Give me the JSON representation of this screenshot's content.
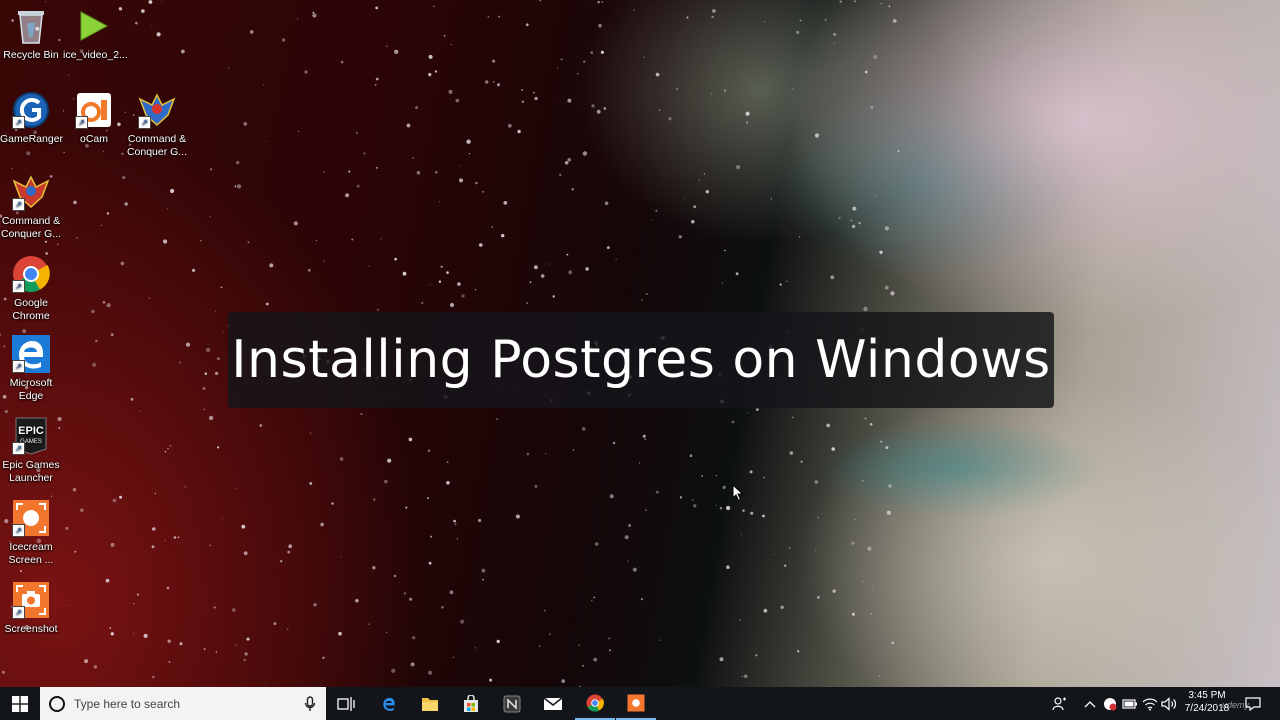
{
  "desktop": {
    "icons": [
      {
        "label": "Recycle Bin",
        "icon": "recycle-bin-icon"
      },
      {
        "label": "ice_video_2...",
        "icon": "video-file-icon"
      },
      {
        "label": "GameRanger",
        "icon": "gameranger-icon"
      },
      {
        "label": "oCam",
        "icon": "ocam-icon"
      },
      {
        "label": "Command & Conquer G...",
        "icon": "command-conquer-icon"
      },
      {
        "label": "Command & Conquer G...",
        "icon": "command-conquer-icon"
      },
      {
        "label": "Google Chrome",
        "icon": "chrome-icon"
      },
      {
        "label": "Microsoft Edge",
        "icon": "edge-icon"
      },
      {
        "label": "Epic Games Launcher",
        "icon": "epic-games-icon"
      },
      {
        "label": "Icecream Screen ...",
        "icon": "icecream-icon"
      },
      {
        "label": "Screenshot",
        "icon": "screenshot-icon"
      }
    ]
  },
  "overlay": {
    "title": "Installing Postgres on Windows"
  },
  "taskbar": {
    "search_placeholder": "Type here to search",
    "apps": [
      {
        "name": "task-view-icon"
      },
      {
        "name": "edge-icon"
      },
      {
        "name": "file-explorer-icon"
      },
      {
        "name": "store-icon"
      },
      {
        "name": "notion-icon"
      },
      {
        "name": "mail-icon"
      },
      {
        "name": "chrome-icon"
      },
      {
        "name": "icecream-icon"
      }
    ],
    "clock": {
      "time": "3:45 PM",
      "date": "7/24/2018"
    }
  },
  "watermark": "udemy",
  "colors": {
    "taskbar": "#121519",
    "banner": "#16161a",
    "accent": "#76b9ed"
  }
}
